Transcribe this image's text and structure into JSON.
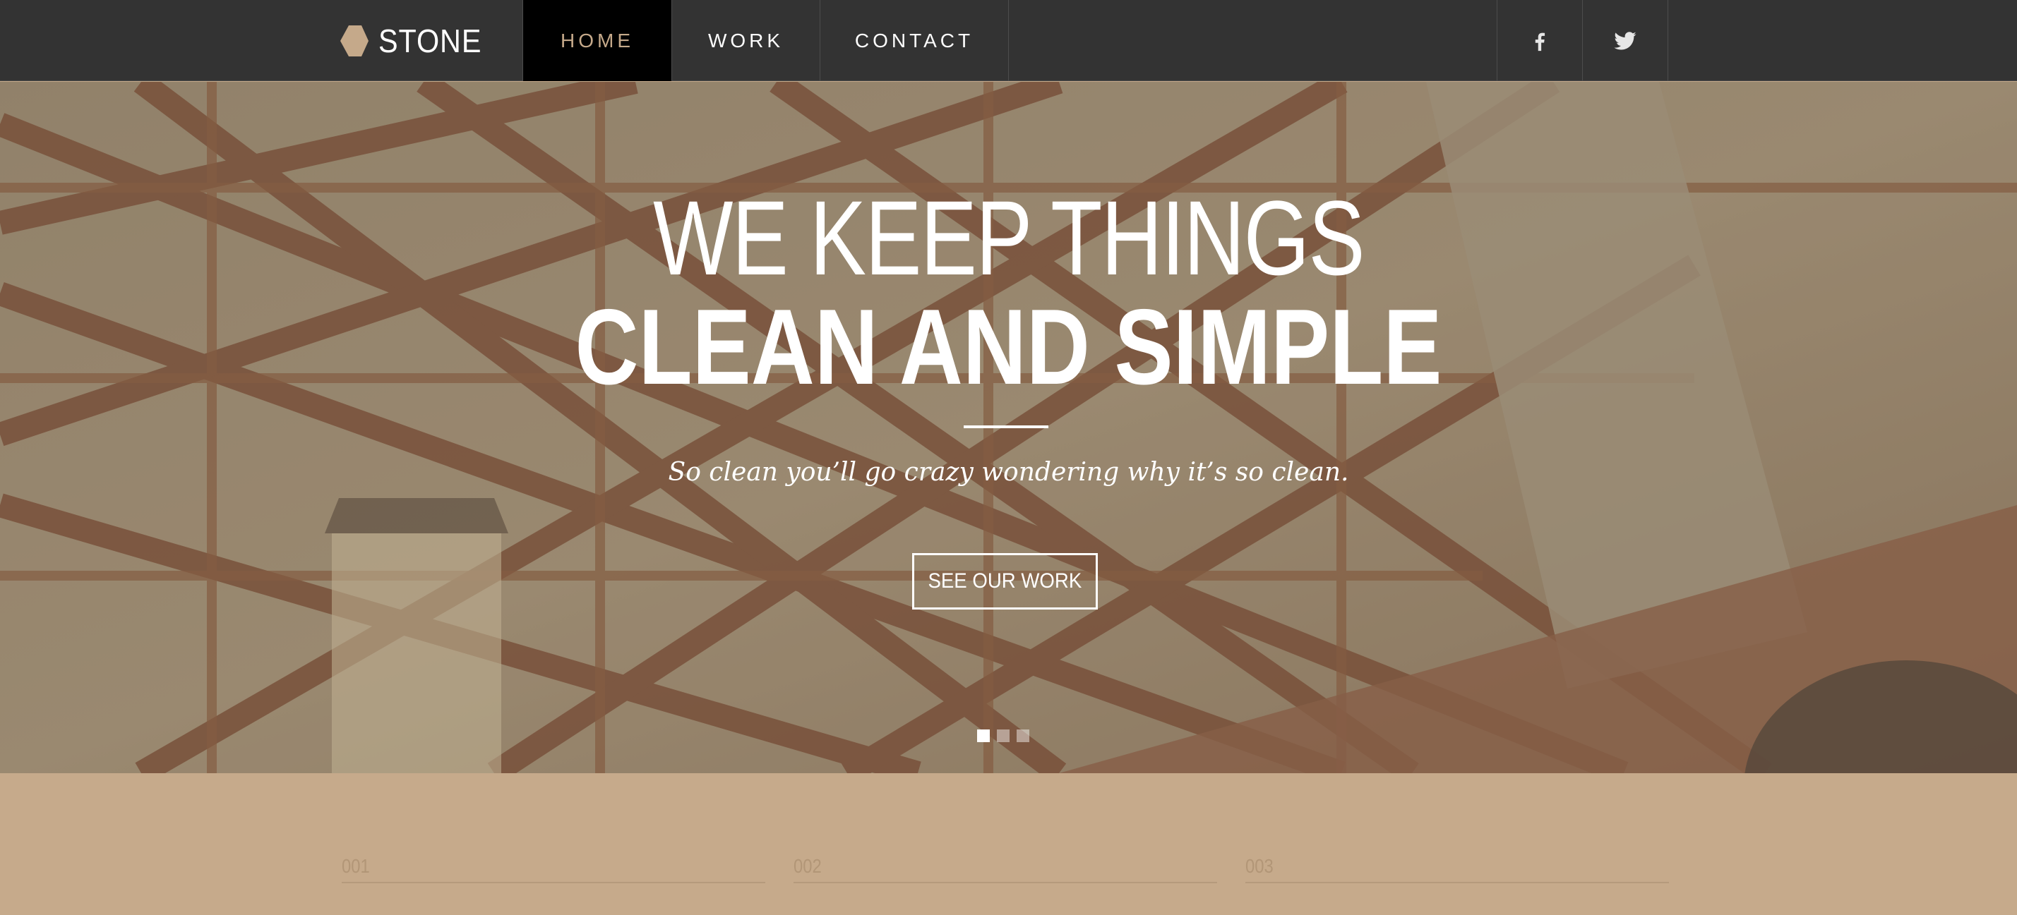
{
  "brand": {
    "name": "STONE",
    "accent_color": "#c5a98a"
  },
  "nav": {
    "items": [
      {
        "label": "HOME",
        "active": true
      },
      {
        "label": "WORK",
        "active": false
      },
      {
        "label": "CONTACT",
        "active": false
      }
    ],
    "social": [
      {
        "icon": "facebook-icon"
      },
      {
        "icon": "twitter-icon"
      }
    ]
  },
  "hero": {
    "line1": "WE KEEP THINGS",
    "line2": "CLEAN AND SIMPLE",
    "tagline": "So clean you’ll go crazy wondering why it’s so clean.",
    "cta_label": "SEE OUR WORK",
    "slides": {
      "count": 3,
      "active_index": 0
    }
  },
  "features": {
    "items": [
      {
        "number": "001"
      },
      {
        "number": "002"
      },
      {
        "number": "003"
      }
    ]
  },
  "colors": {
    "nav_bg": "#333333",
    "active_bg": "#000000",
    "section_bg": "#c6aa8b"
  }
}
